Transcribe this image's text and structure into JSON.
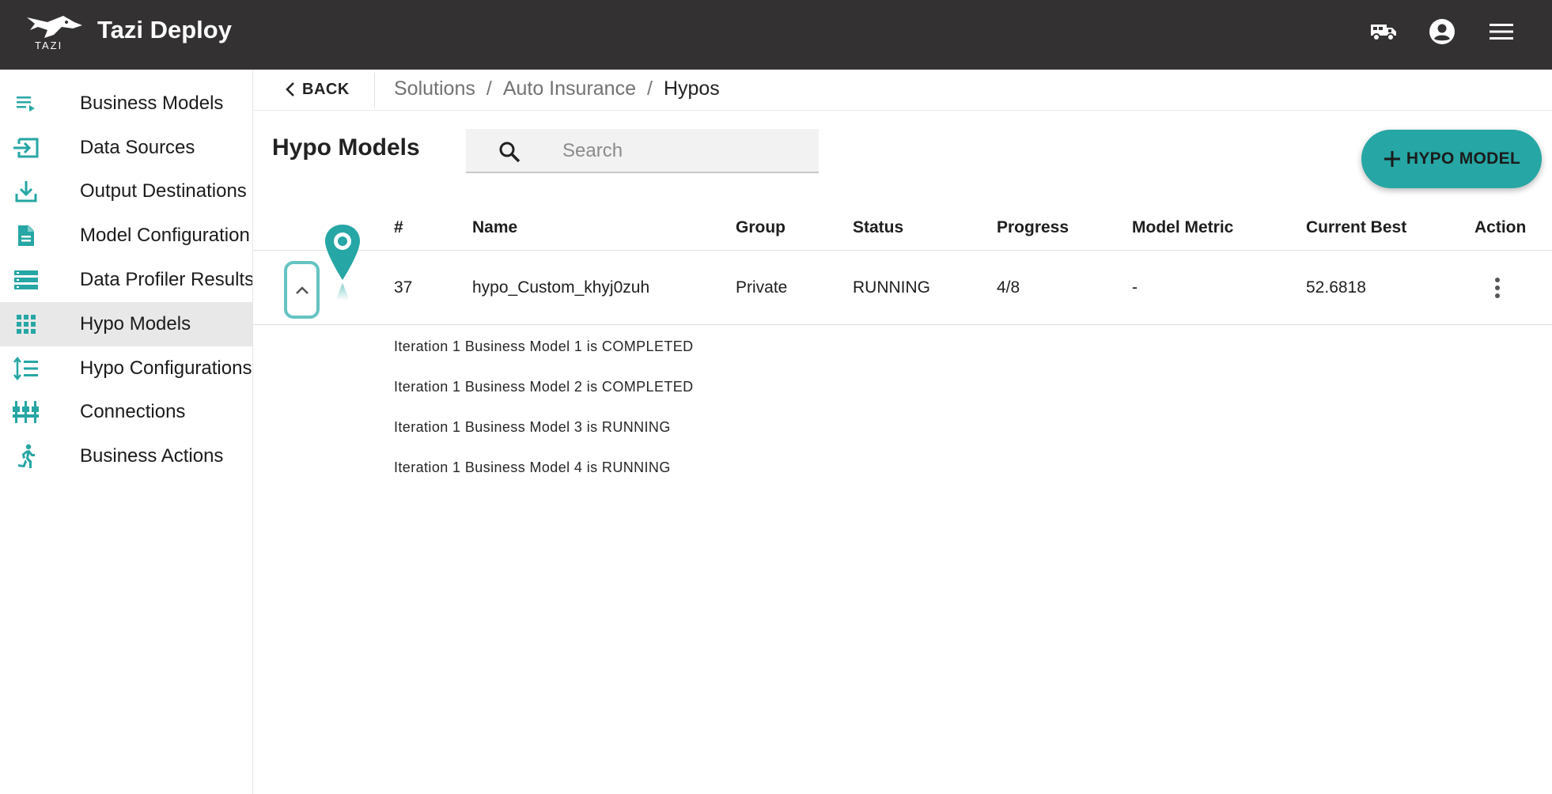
{
  "app": {
    "title": "Tazi Deploy",
    "logo_text": "TAZI"
  },
  "topbar": {
    "icons": [
      "truck-icon",
      "account-icon",
      "menu-icon"
    ]
  },
  "sidebar": {
    "items": [
      {
        "label": "Business Models",
        "icon": "playlist-icon"
      },
      {
        "label": "Data Sources",
        "icon": "input-icon"
      },
      {
        "label": "Output Destinations",
        "icon": "download-icon"
      },
      {
        "label": "Model Configuration",
        "icon": "document-icon"
      },
      {
        "label": "Data Profiler Results",
        "icon": "storage-icon"
      },
      {
        "label": "Hypo Models",
        "icon": "grid-icon",
        "active": true
      },
      {
        "label": "Hypo Configurations",
        "icon": "format-line-spacing-icon"
      },
      {
        "label": "Connections",
        "icon": "tune-icon"
      },
      {
        "label": "Business Actions",
        "icon": "run-icon"
      }
    ]
  },
  "breadcrumb": {
    "back_label": "BACK",
    "items": [
      "Solutions",
      "Auto Insurance",
      "Hypos"
    ],
    "separator": "/"
  },
  "main": {
    "title": "Hypo Models",
    "search_placeholder": "Search",
    "add_button_label": "HYPO MODEL"
  },
  "table": {
    "headers": [
      "#",
      "Name",
      "Group",
      "Status",
      "Progress",
      "Model Metric",
      "Current Best",
      "Action"
    ],
    "rows": [
      {
        "id": "37",
        "name": "hypo_Custom_khyj0zuh",
        "group": "Private",
        "status": "RUNNING",
        "progress": "4/8",
        "model_metric": "-",
        "current_best": "52.6818",
        "expanded": true,
        "details": [
          "Iteration 1 Business Model 1 is COMPLETED",
          "Iteration 1 Business Model 2 is COMPLETED",
          "Iteration 1 Business Model 3 is RUNNING",
          "Iteration 1 Business Model 4 is RUNNING"
        ]
      }
    ]
  },
  "colors": {
    "topbar": "#333132",
    "accent": "#26a6a4",
    "active_nav": "#e8e8e8"
  }
}
